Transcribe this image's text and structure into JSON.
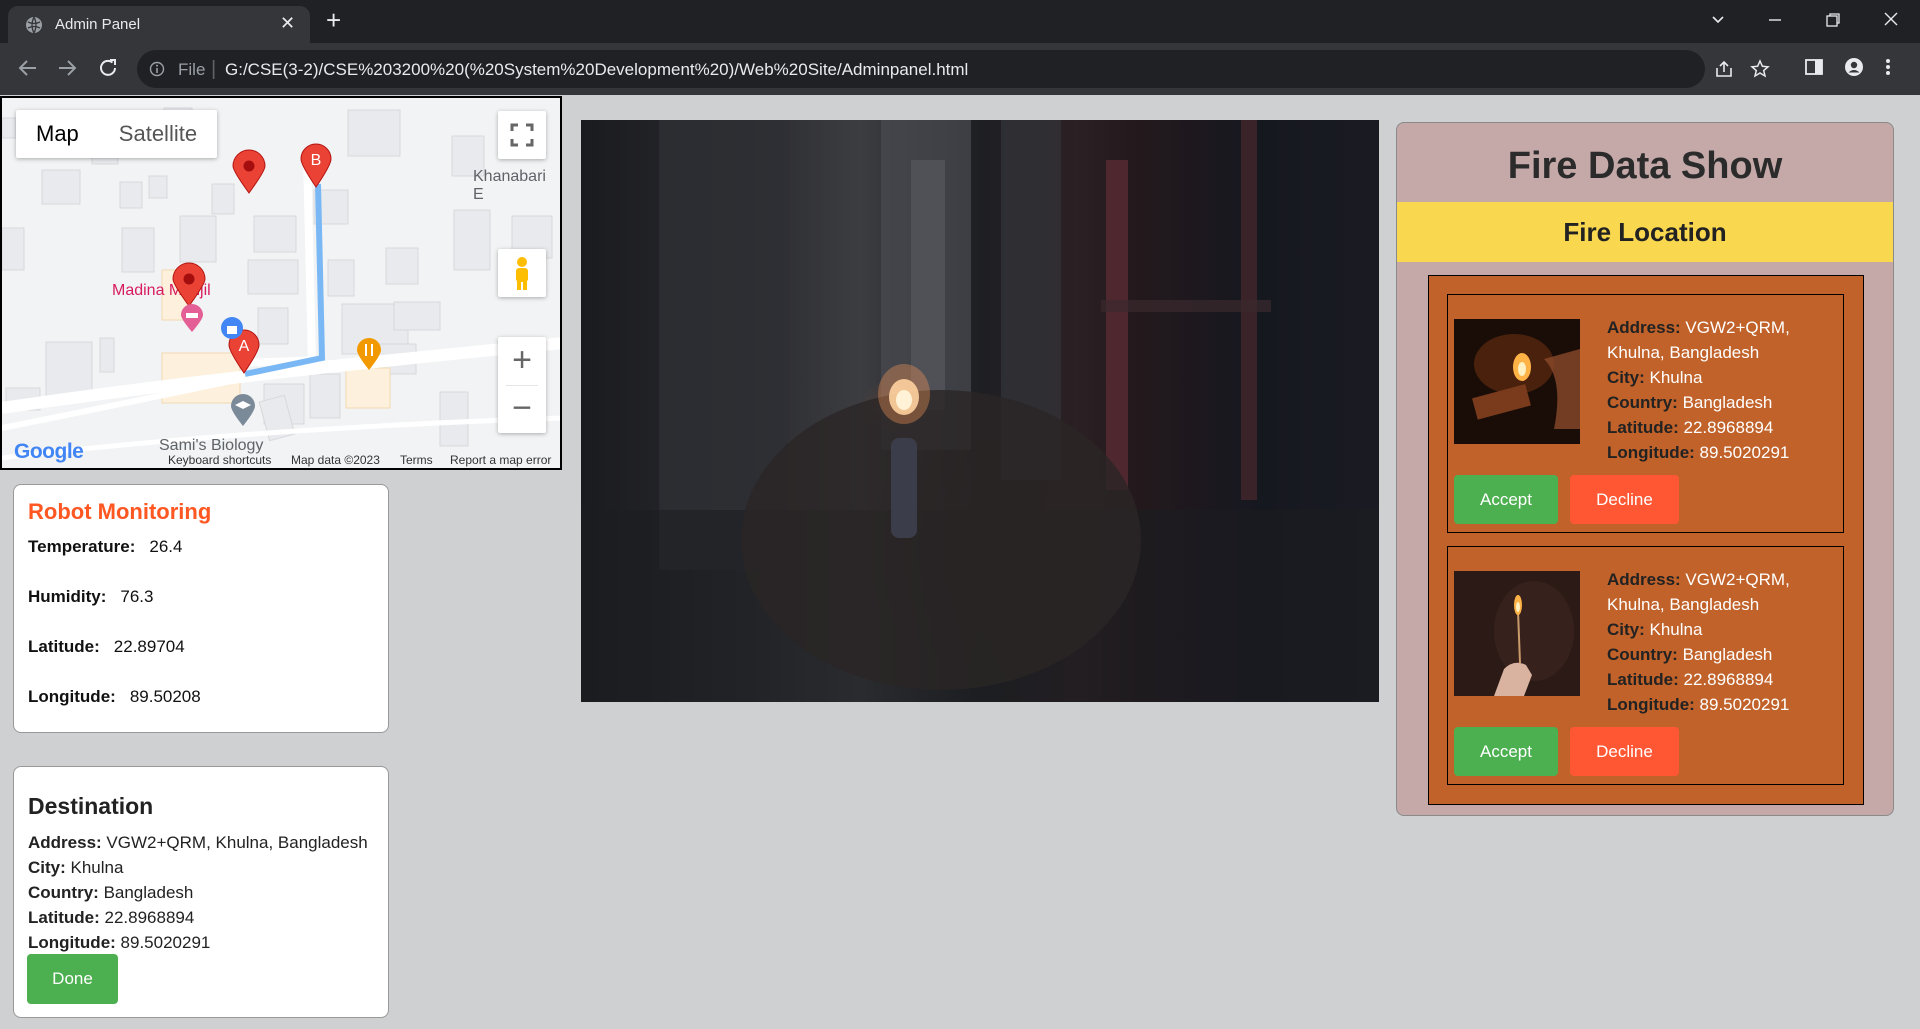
{
  "browser": {
    "tab_title": "Admin Panel",
    "tab_close": "✕",
    "new_tab": "+",
    "url_scheme": "File",
    "url_separator": "|",
    "url": "G:/CSE(3-2)/CSE%203200%20(%20System%20Development%20)/Web%20Site/Adminpanel.html"
  },
  "map": {
    "type_map": "Map",
    "type_satellite": "Satellite",
    "labels": {
      "khanabari": "Khanabari E",
      "madina": "Madina Manjil",
      "samis": "Sami's Biology"
    },
    "marker_a": "A",
    "marker_b": "B",
    "zoom_in": "+",
    "zoom_out": "−",
    "google": "Google",
    "footer": {
      "shortcuts": "Keyboard shortcuts",
      "data": "Map data ©2023",
      "terms": "Terms",
      "report": "Report a map error"
    }
  },
  "robot": {
    "title": "Robot Monitoring",
    "temperature_label": "Temperature:",
    "temperature": "26.4",
    "humidity_label": "Humidity:",
    "humidity": "76.3",
    "latitude_label": "Latitude:",
    "latitude": "22.89704",
    "longitude_label": "Longitude:",
    "longitude": "89.50208"
  },
  "destination": {
    "title": "Destination",
    "address_label": "Address:",
    "address": "VGW2+QRM, Khulna, Bangladesh",
    "city_label": "City:",
    "city": "Khulna",
    "country_label": "Country:",
    "country": "Bangladesh",
    "latitude_label": "Latitude:",
    "latitude": "22.8968894",
    "longitude_label": "Longitude:",
    "longitude": "89.5020291",
    "done_label": "Done"
  },
  "fire": {
    "title": "Fire Data Show",
    "subtitle": "Fire Location",
    "accept_label": "Accept",
    "decline_label": "Decline",
    "items": [
      {
        "address_label": "Address:",
        "address": "VGW2+QRM, Khulna, Bangladesh",
        "city_label": "City:",
        "city": "Khulna",
        "country_label": "Country:",
        "country": "Bangladesh",
        "latitude_label": "Latitude:",
        "latitude": "22.8968894",
        "longitude_label": "Longitude:",
        "longitude": "89.5020291"
      },
      {
        "address_label": "Address:",
        "address": "VGW2+QRM, Khulna, Bangladesh",
        "city_label": "City:",
        "city": "Khulna",
        "country_label": "Country:",
        "country": "Bangladesh",
        "latitude_label": "Latitude:",
        "latitude": "22.8968894",
        "longitude_label": "Longitude:",
        "longitude": "89.5020291"
      }
    ]
  },
  "colors": {
    "accent_orange": "#ff5722",
    "accept_green": "#4caf50",
    "decline_red": "#ff5733",
    "fire_band_yellow": "#f9d74f",
    "fire_list_brown": "#c0622a"
  }
}
